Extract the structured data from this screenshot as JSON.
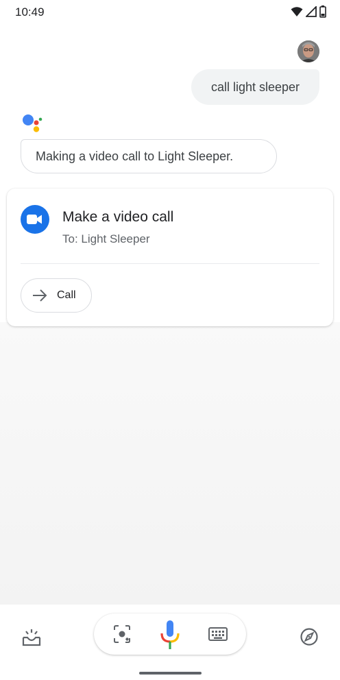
{
  "status_bar": {
    "time": "10:49",
    "icons": [
      "wifi-icon",
      "signal-icon",
      "battery-icon"
    ]
  },
  "conversation": {
    "user_query": "call light sleeper",
    "assistant_response": "Making a video call to Light Sleeper."
  },
  "card": {
    "app_icon": "video-camera-icon",
    "title": "Make a video call",
    "subtitle": "To: Light Sleeper",
    "action_label": "Call",
    "action_icon": "arrow-right-icon"
  },
  "bottom_bar": {
    "left_icon": "updates-tray-icon",
    "center_icons": [
      "lens-icon",
      "mic-icon",
      "keyboard-icon"
    ],
    "right_icon": "compass-icon"
  },
  "colors": {
    "accent_blue": "#1a73e8",
    "google_red": "#ea4335",
    "google_yellow": "#fbbc04",
    "google_green": "#34a853",
    "google_blue": "#4285f4"
  }
}
